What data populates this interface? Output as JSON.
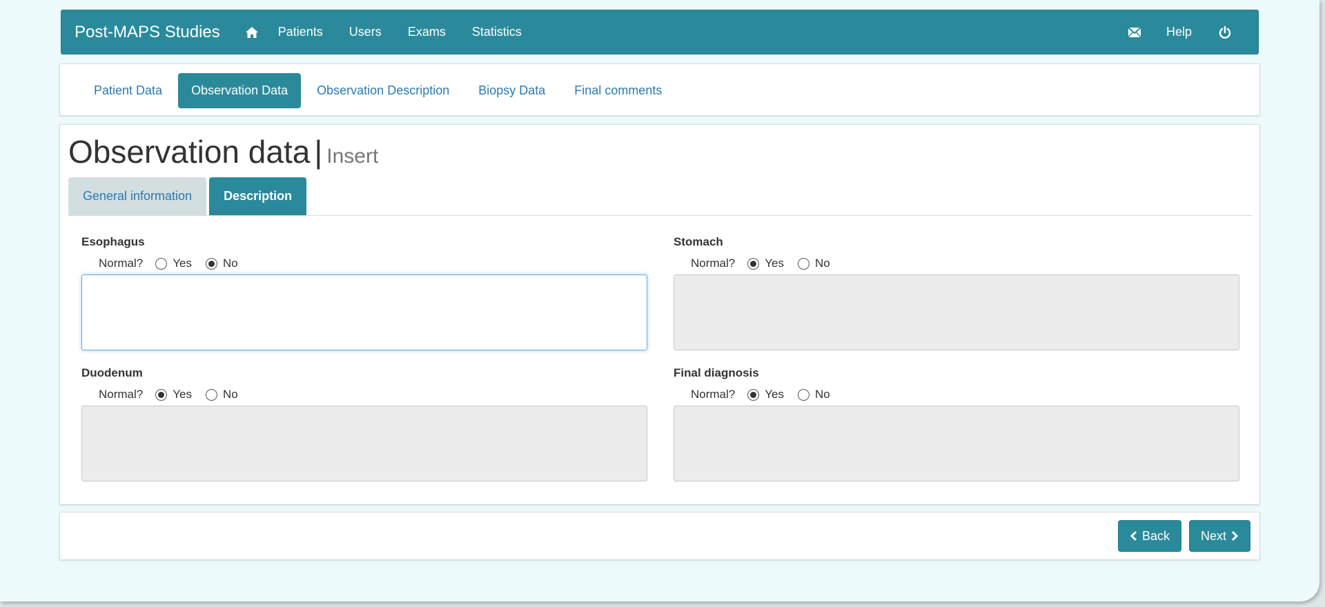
{
  "navbar": {
    "brand": "Post-MAPS Studies",
    "links": [
      "Patients",
      "Users",
      "Exams",
      "Statistics"
    ],
    "help": "Help",
    "icons": [
      "home-icon",
      "mail-icon",
      "power-icon"
    ]
  },
  "steps": [
    {
      "label": "Patient Data",
      "active": false
    },
    {
      "label": "Observation Data",
      "active": true
    },
    {
      "label": "Observation Description",
      "active": false
    },
    {
      "label": "Biopsy Data",
      "active": false
    },
    {
      "label": "Final comments",
      "active": false
    }
  ],
  "page": {
    "title": "Observation data",
    "separator": "|",
    "subtitle": "Insert"
  },
  "tabs": [
    {
      "label": "General information",
      "active": false
    },
    {
      "label": "Description",
      "active": true
    }
  ],
  "fields": {
    "esophagus": {
      "label": "Esophagus",
      "question": "Normal?",
      "yes": "Yes",
      "no": "No",
      "selected": "No",
      "value": ""
    },
    "stomach": {
      "label": "Stomach",
      "question": "Normal?",
      "yes": "Yes",
      "no": "No",
      "selected": "Yes",
      "value": ""
    },
    "duodenum": {
      "label": "Duodenum",
      "question": "Normal?",
      "yes": "Yes",
      "no": "No",
      "selected": "Yes",
      "value": ""
    },
    "final_diagnosis": {
      "label": "Final diagnosis",
      "question": "Normal?",
      "yes": "Yes",
      "no": "No",
      "selected": "Yes",
      "value": ""
    }
  },
  "footer": {
    "back": "Back",
    "next": "Next"
  },
  "colors": {
    "primary": "#2a8a9c",
    "link": "#2a7ab0",
    "background": "#edfafb"
  }
}
